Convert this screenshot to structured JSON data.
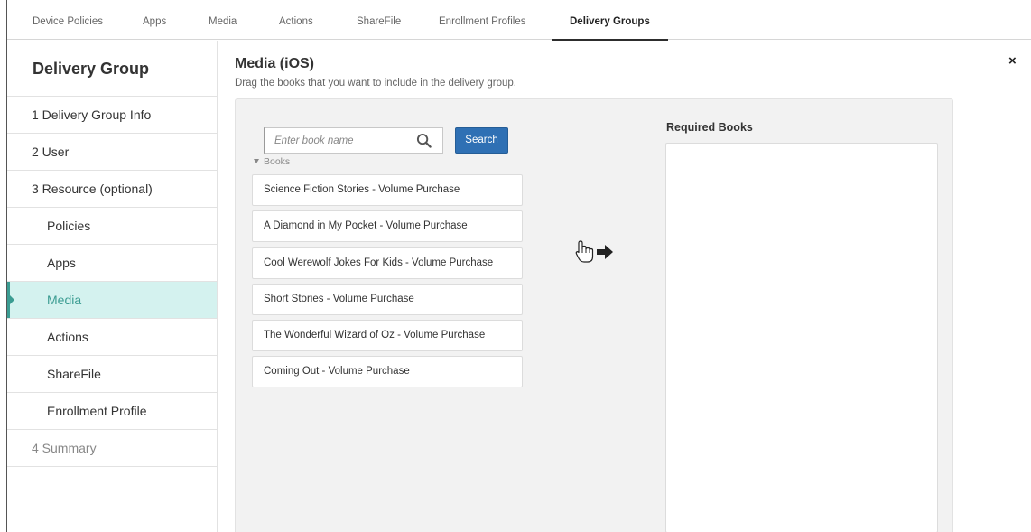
{
  "topnav": {
    "tabs": [
      {
        "label": "Device Policies"
      },
      {
        "label": "Apps"
      },
      {
        "label": "Media"
      },
      {
        "label": "Actions"
      },
      {
        "label": "ShareFile"
      },
      {
        "label": "Enrollment Profiles"
      },
      {
        "label": "Delivery Groups",
        "active": true
      }
    ]
  },
  "sidebar": {
    "heading": "Delivery Group",
    "items": [
      {
        "label": "1  Delivery Group Info"
      },
      {
        "label": "2  User"
      },
      {
        "label": "3  Resource (optional)"
      },
      {
        "label": "Policies"
      },
      {
        "label": "Apps"
      },
      {
        "label": "Media",
        "active": true
      },
      {
        "label": "Actions"
      },
      {
        "label": "ShareFile"
      },
      {
        "label": "Enrollment Profile"
      },
      {
        "label": "4  Summary"
      }
    ]
  },
  "main": {
    "close_label": "×",
    "title": "Media (iOS)",
    "subtitle": "Drag the books that you want to include in the delivery group.",
    "search": {
      "placeholder": "Enter book name",
      "value": "",
      "button_label": "Search",
      "icon": "search-icon"
    },
    "books_group_label": "Books",
    "books": [
      "Science Fiction Stories - Volume Purchase",
      "A Diamond in My Pocket - Volume Purchase",
      "Cool Werewolf Jokes For Kids - Volume Purchase",
      "Short Stories - Volume Purchase",
      "The Wonderful Wizard of Oz - Volume Purchase",
      "Coming Out - Volume Purchase"
    ],
    "drag_icons": [
      "hand-pointer-icon",
      "arrow-right-icon"
    ],
    "required_books_label": "Required Books",
    "required_books": []
  },
  "colors": {
    "primary_button": "#2f70b4",
    "active_sidebar_bg": "#d4f2ef",
    "active_sidebar_text": "#3b9c92",
    "panel_bg": "#f2f2f2"
  }
}
